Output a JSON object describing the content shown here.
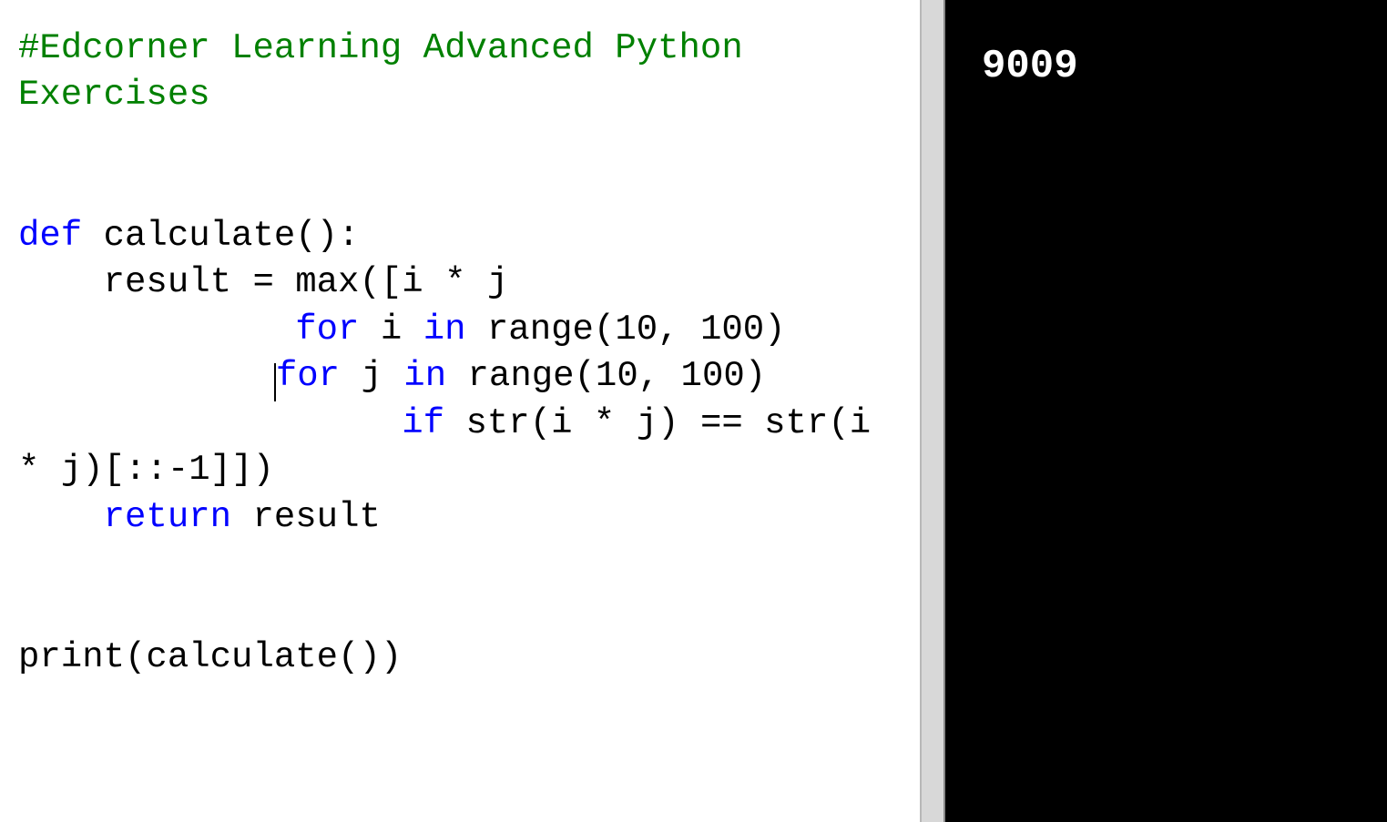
{
  "code": {
    "line1": "#Edcorner Learning Advanced Python",
    "line2": "Exercises",
    "line3_def": "def",
    "line3_rest": " calculate():",
    "line4_indent": "    result = ",
    "line4_max": "max",
    "line4_rest": "([i * j",
    "line5_indent": "             ",
    "line5_for": "for",
    "line5_mid": " i ",
    "line5_in": "in",
    "line5_rest": " range(10, 100)",
    "line6_indent": "            ",
    "line6_for": "for",
    "line6_mid": " j ",
    "line6_in": "in",
    "line6_rest": " range(10, 100)",
    "line7_indent": "                  ",
    "line7_if": "if",
    "line7_mid": " str(i * j) == str(i",
    "line8": "* j)[::-1]])",
    "line9_indent": "    ",
    "line9_return": "return",
    "line9_rest": " result",
    "line10": "print(calculate())"
  },
  "output": {
    "value": "9009"
  }
}
